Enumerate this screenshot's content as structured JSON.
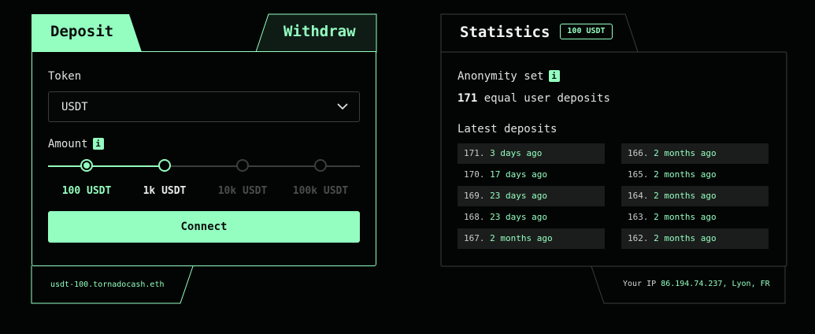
{
  "tabs": {
    "deposit": "Deposit",
    "withdraw": "Withdraw"
  },
  "token": {
    "label": "Token",
    "selected": "USDT"
  },
  "amount": {
    "label": "Amount",
    "info": "i",
    "options": [
      "100 USDT",
      "1k USDT",
      "10k USDT",
      "100k USDT"
    ],
    "selected_index": 0,
    "colors": {
      "selected": "#94fec0",
      "available": "#e8eae9",
      "disabled": "#4a4d4c"
    }
  },
  "connect_label": "Connect",
  "ens_name": "usdt-100.tornadocash.eth",
  "stats": {
    "title": "Statistics",
    "badge": "100 USDT",
    "anonymity_label": "Anonymity set",
    "info": "i",
    "count": "171",
    "count_suffix": "equal user deposits",
    "latest_label": "Latest deposits",
    "left_col": [
      {
        "num": "171.",
        "age": "3 days ago"
      },
      {
        "num": "170.",
        "age": "17 days ago"
      },
      {
        "num": "169.",
        "age": "23 days ago"
      },
      {
        "num": "168.",
        "age": "23 days ago"
      },
      {
        "num": "167.",
        "age": "2 months ago"
      }
    ],
    "right_col": [
      {
        "num": "166.",
        "age": "2 months ago"
      },
      {
        "num": "165.",
        "age": "2 months ago"
      },
      {
        "num": "164.",
        "age": "2 months ago"
      },
      {
        "num": "163.",
        "age": "2 months ago"
      },
      {
        "num": "162.",
        "age": "2 months ago"
      }
    ]
  },
  "ip": {
    "prefix": "Your IP",
    "value": "86.194.74.237, Lyon, FR"
  },
  "accent": "#94fec0"
}
